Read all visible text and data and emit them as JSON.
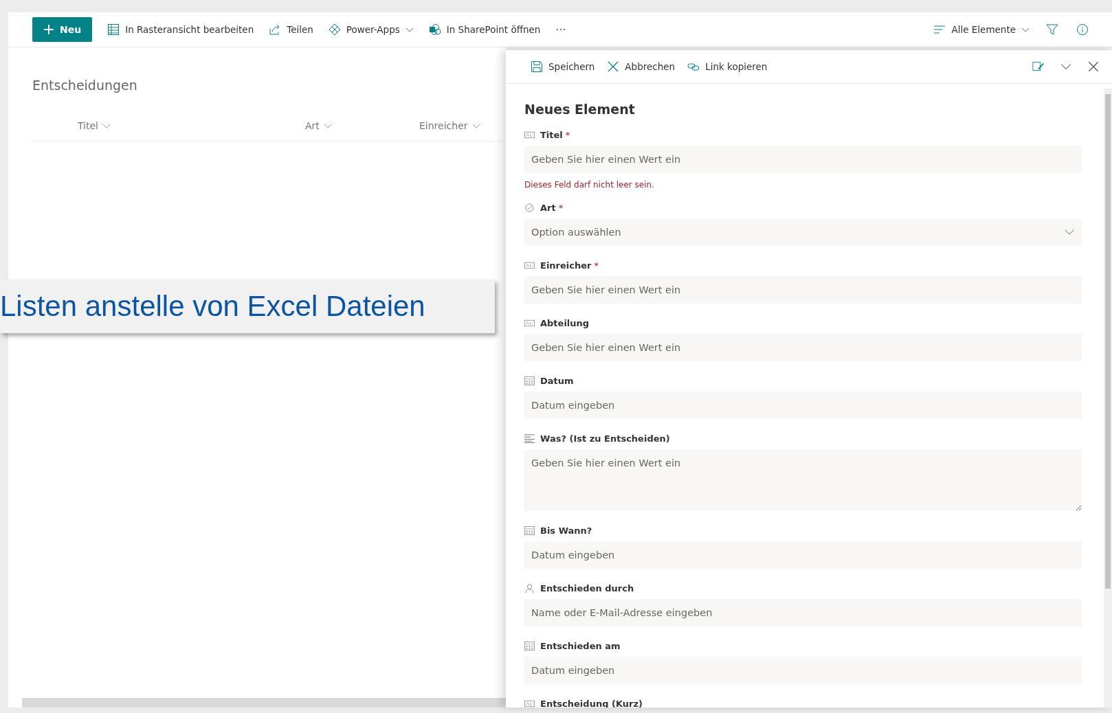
{
  "command_bar": {
    "new_button": "Neu",
    "actions": [
      {
        "kind": "grid",
        "label": "In Rasteransicht bearbeiten"
      },
      {
        "kind": "share",
        "label": "Teilen"
      },
      {
        "kind": "powerapps",
        "label": "Power-Apps",
        "dropdown": true
      },
      {
        "kind": "sharepoint",
        "label": "In SharePoint öffnen"
      }
    ],
    "more": "···",
    "view": "Alle Elemente"
  },
  "list": {
    "title": "Entscheidungen",
    "columns": [
      "Titel",
      "Art",
      "Einreicher"
    ]
  },
  "banner": "Listen anstelle von Excel Dateien",
  "panel": {
    "actions": [
      {
        "kind": "save",
        "label": "Speichern"
      },
      {
        "kind": "cancel",
        "label": "Abbrechen"
      },
      {
        "kind": "link",
        "label": "Link kopieren"
      }
    ],
    "title": "Neues Element",
    "fields": [
      {
        "kind": "text",
        "label": "Titel",
        "required_mark": "*",
        "placeholder": "Geben Sie hier einen Wert ein",
        "error": "Dieses Feld darf nicht leer sein."
      },
      {
        "kind": "choice",
        "label": "Art",
        "required_mark": "*",
        "placeholder": "Option auswählen"
      },
      {
        "kind": "text",
        "label": "Einreicher",
        "required_mark": "*",
        "placeholder": "Geben Sie hier einen Wert ein"
      },
      {
        "kind": "text",
        "label": "Abteilung",
        "placeholder": "Geben Sie hier einen Wert ein"
      },
      {
        "kind": "date",
        "label": "Datum",
        "placeholder": "Datum eingeben"
      },
      {
        "kind": "note",
        "label": "Was? (Ist zu Entscheiden)",
        "placeholder": "Geben Sie hier einen Wert ein"
      },
      {
        "kind": "date",
        "label": "Bis Wann?",
        "placeholder": "Datum eingeben"
      },
      {
        "kind": "person",
        "label": "Entschieden durch",
        "placeholder": "Name oder E-Mail-Adresse eingeben"
      },
      {
        "kind": "date",
        "label": "Entschieden am",
        "placeholder": "Datum eingeben"
      },
      {
        "kind": "text",
        "label": "Entscheidung (Kurz)"
      }
    ]
  }
}
